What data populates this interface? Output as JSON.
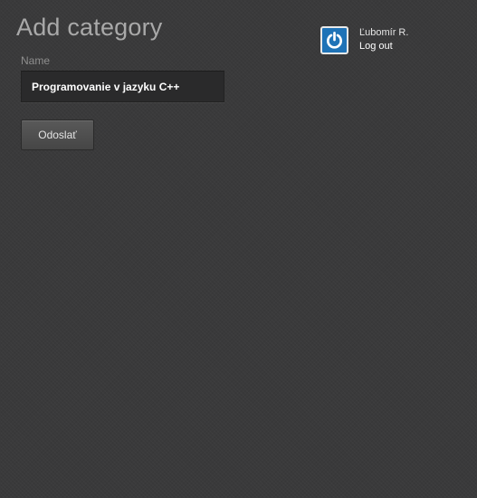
{
  "header": {
    "title": "Add category"
  },
  "form": {
    "name_label": "Name",
    "name_value": "Programovanie v jazyku C++",
    "submit_label": "Odoslať"
  },
  "user": {
    "name": "Ľubomír R.",
    "logout_label": "Log out",
    "avatar_icon": "power-icon",
    "avatar_color": "#1f73b7"
  }
}
